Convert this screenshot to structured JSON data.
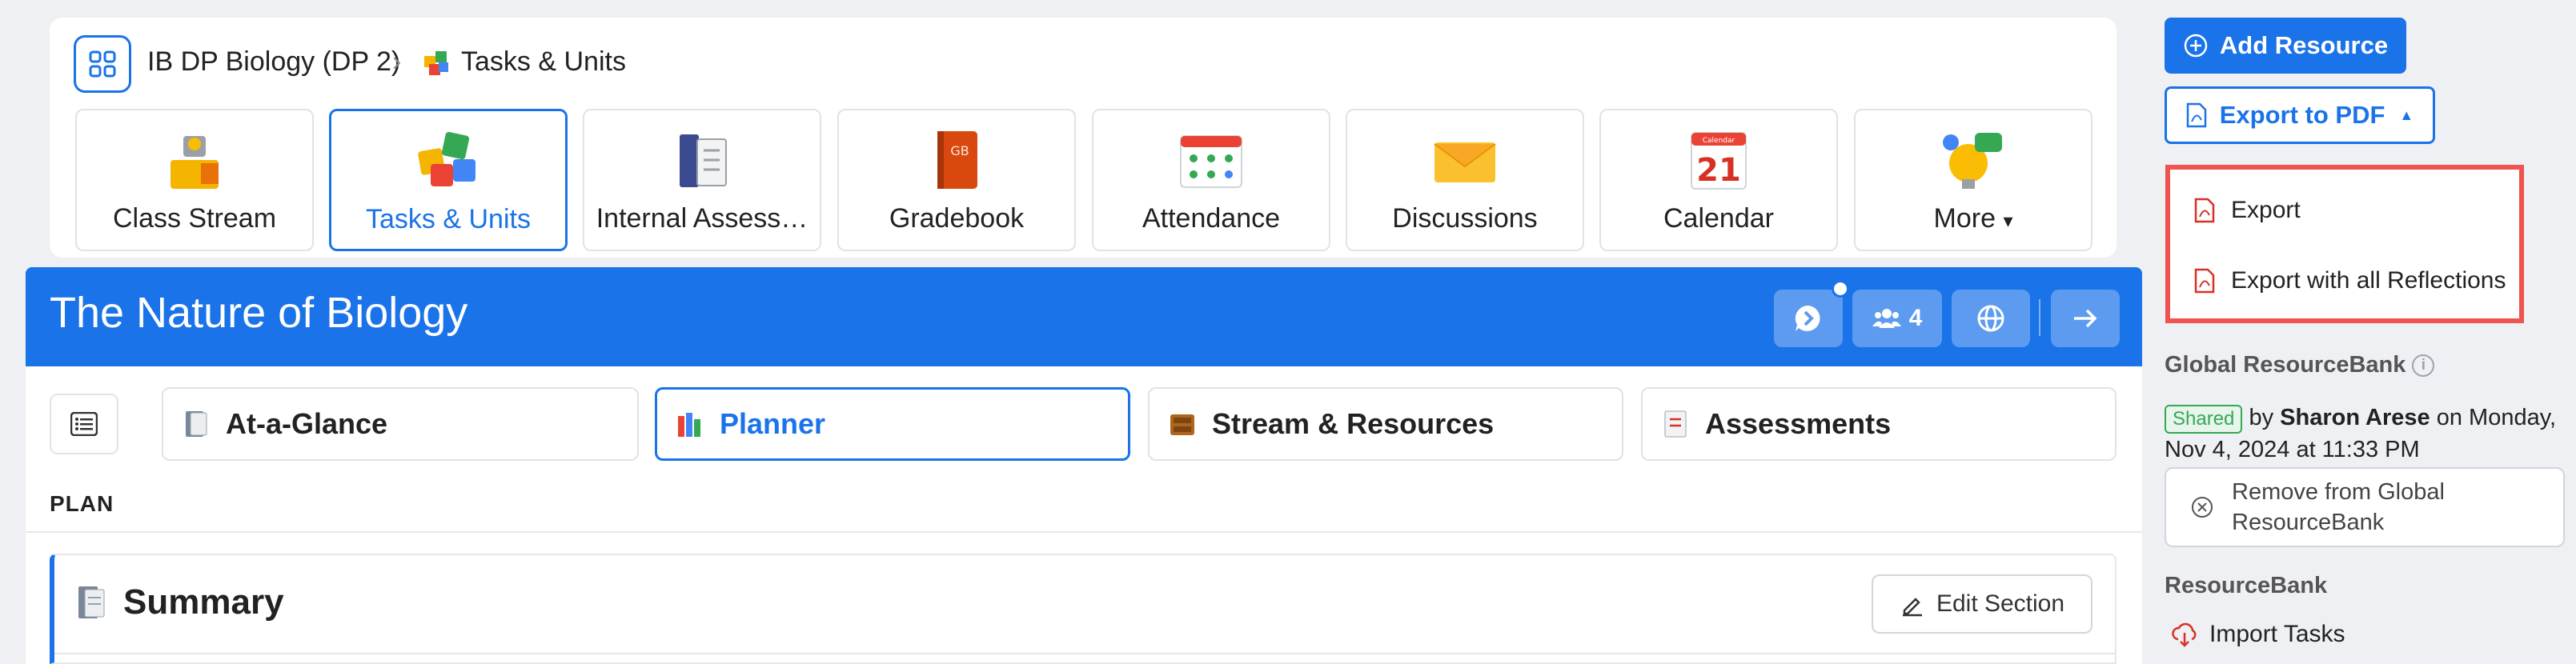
{
  "breadcrumb": {
    "course": "IB DP Biology (DP 2)",
    "section": "Tasks & Units"
  },
  "nav_tiles": [
    {
      "label": "Class Stream",
      "icon": "class-stream-icon"
    },
    {
      "label": "Tasks & Units",
      "icon": "puzzle-icon",
      "active": true
    },
    {
      "label": "Internal Assess…",
      "icon": "book-icon"
    },
    {
      "label": "Gradebook",
      "icon": "gradebook-icon"
    },
    {
      "label": "Attendance",
      "icon": "attendance-icon"
    },
    {
      "label": "Discussions",
      "icon": "envelope-icon"
    },
    {
      "label": "Calendar",
      "icon": "calendar-icon",
      "calendar_day": "21",
      "calendar_header": "Calendar"
    },
    {
      "label": "More",
      "icon": "more-icon",
      "caret": "▾"
    }
  ],
  "unit": {
    "title": "The Nature of Biology",
    "members_count": "4"
  },
  "tabs": [
    {
      "label": "At-a-Glance"
    },
    {
      "label": "Planner",
      "active": true
    },
    {
      "label": "Stream & Resources"
    },
    {
      "label": "Assessments"
    }
  ],
  "plan_label": "PLAN",
  "summary": {
    "title": "Summary",
    "edit_label": "Edit Section"
  },
  "sidebar": {
    "add_resource": "Add Resource",
    "export_pdf": "Export to PDF",
    "export_menu": [
      "Export",
      "Export with all Reflections"
    ],
    "global_rb_title": "Global ResourceBank",
    "shared_badge": "Shared",
    "shared_by_pre": "by",
    "shared_by_name": "Sharon Arese",
    "shared_date": "on Monday, Nov 4, 2024 at 11:33 PM",
    "remove_label": "Remove from Global ResourceBank",
    "rb_title": "ResourceBank",
    "import_label": "Import Tasks"
  },
  "colors": {
    "accent": "#1a73e8",
    "highlight": "#ef5350",
    "shared": "#34a853"
  }
}
